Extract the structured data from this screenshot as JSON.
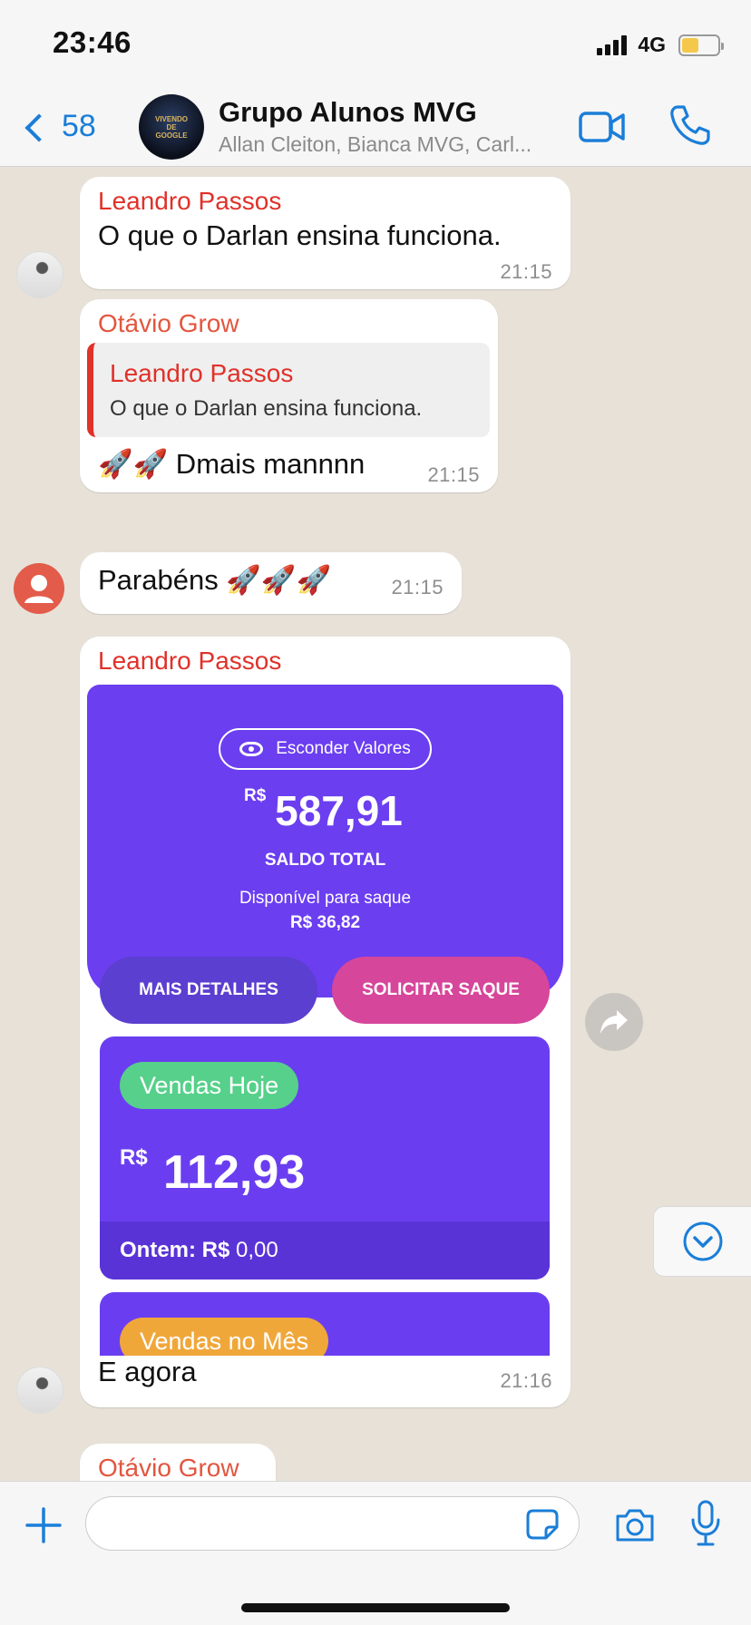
{
  "status": {
    "time": "23:46",
    "network": "4G",
    "battery_level": 0.48,
    "signal_bars": 4
  },
  "header": {
    "back_count": "58",
    "group_name": "Grupo Alunos MVG",
    "participants": "Allan Cleiton, Bianca MVG, Carl...",
    "avatar_text": "VIVENDO DE GOOGLE"
  },
  "colors": {
    "accent_blue": "#1a7ed8",
    "sender_red": "#e0312a",
    "chat_bg": "#e7e1d8"
  },
  "messages": [
    {
      "sender": "Leandro Passos",
      "text": "O que o Darlan ensina funciona.",
      "time": "21:15"
    },
    {
      "sender": "Otávio Grow",
      "quote": {
        "sender": "Leandro Passos",
        "text": "O que o Darlan ensina funciona."
      },
      "text": "🚀🚀 Dmais mannnn",
      "time": "21:15"
    },
    {
      "text": "Parabéns 🚀🚀🚀",
      "time": "21:15"
    },
    {
      "sender": "Leandro Passos",
      "image": {
        "toggle_label": "Esconder Valores",
        "currency": "R$",
        "total": "587,91",
        "total_label": "SALDO TOTAL",
        "available_label": "Disponível para saque",
        "available": "R$ 36,82",
        "btn_details": "MAIS DETALHES",
        "btn_withdraw": "SOLICITAR SAQUE",
        "today_badge": "Vendas Hoje",
        "today_value": "112,93",
        "yesterday_label": "Ontem: R$",
        "yesterday_value": "0,00",
        "month_badge": "Vendas no Mês"
      },
      "text": "E agora",
      "time": "21:16"
    },
    {
      "sender": "Otávio Grow"
    }
  ],
  "input": {
    "placeholder": ""
  }
}
